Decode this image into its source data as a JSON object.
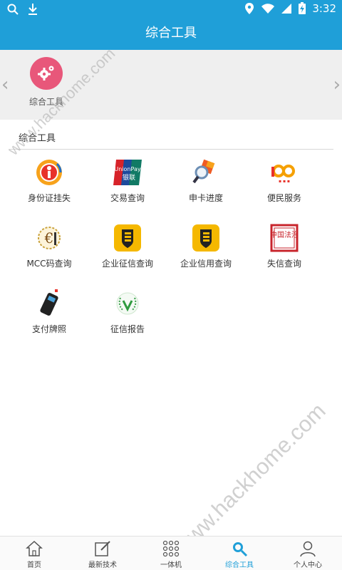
{
  "status_bar": {
    "time": "3:32"
  },
  "header": {
    "title": "综合工具"
  },
  "banner": {
    "item_label": "综合工具",
    "icon": "gear-icon",
    "accent": "#e8577a"
  },
  "section": {
    "title": "综合工具"
  },
  "tools": [
    {
      "label": "身份证挂失",
      "icon": "id-card-loss-icon"
    },
    {
      "label": "交易查询",
      "icon": "unionpay-icon"
    },
    {
      "label": "申卡进度",
      "icon": "card-search-icon"
    },
    {
      "label": "便民服务",
      "icon": "convenience-service-icon"
    },
    {
      "label": "MCC码查询",
      "icon": "mcc-code-icon"
    },
    {
      "label": "企业征信查询",
      "icon": "enterprise-credit-icon"
    },
    {
      "label": "企业信用查询",
      "icon": "enterprise-trust-icon"
    },
    {
      "label": "失信查询",
      "icon": "dishonesty-seal-icon"
    },
    {
      "label": "支付牌照",
      "icon": "pos-terminal-icon"
    },
    {
      "label": "征信报告",
      "icon": "credit-report-icon"
    }
  ],
  "unionpay_text": {
    "top": "UnionPay",
    "bottom": "银联"
  },
  "seal_text": "中国法治",
  "watermark": "www.hackhome.com",
  "bottom_nav": [
    {
      "label": "首页",
      "icon": "home-icon"
    },
    {
      "label": "最新技术",
      "icon": "edit-icon"
    },
    {
      "label": "一体机",
      "icon": "grid-dots-icon"
    },
    {
      "label": "综合工具",
      "icon": "search-icon",
      "active": true
    },
    {
      "label": "个人中心",
      "icon": "person-icon"
    }
  ],
  "colors": {
    "primary": "#1f9fd8",
    "banner_bg": "#efefef",
    "credit_yellow": "#f5b800"
  }
}
